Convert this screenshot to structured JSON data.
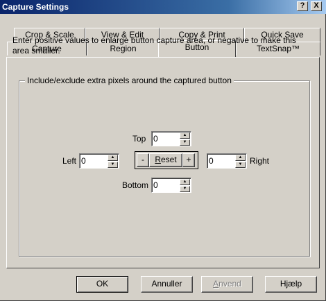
{
  "window": {
    "title": "Capture Settings",
    "help_glyph": "?",
    "close_glyph": "X"
  },
  "tabs": {
    "row1": [
      "Crop & Scale",
      "View & Edit",
      "Copy & Print",
      "Quick Save"
    ],
    "row2": [
      "Capture",
      "Region",
      "Button",
      "TextSnap™"
    ],
    "active": "Button"
  },
  "group": {
    "label": "Include/exclude extra pixels around the captured button",
    "description": "Enter positive values to enlarge button capture area, or negative to make this area smaller."
  },
  "fields": {
    "top": {
      "label": "Top",
      "value": "0"
    },
    "left": {
      "label": "Left",
      "value": "0"
    },
    "right": {
      "label": "Right",
      "value": "0"
    },
    "bottom": {
      "label": "Bottom",
      "value": "0"
    }
  },
  "reset_controls": {
    "minus": "-",
    "reset_prefix": "R",
    "reset_rest": "eset",
    "plus": "+"
  },
  "buttons": {
    "ok": "OK",
    "cancel": "Annuller",
    "apply_prefix": "A",
    "apply_rest": "nvend",
    "help": "Hjælp"
  },
  "arrow_glyphs": {
    "up": "▲",
    "down": "▼"
  }
}
